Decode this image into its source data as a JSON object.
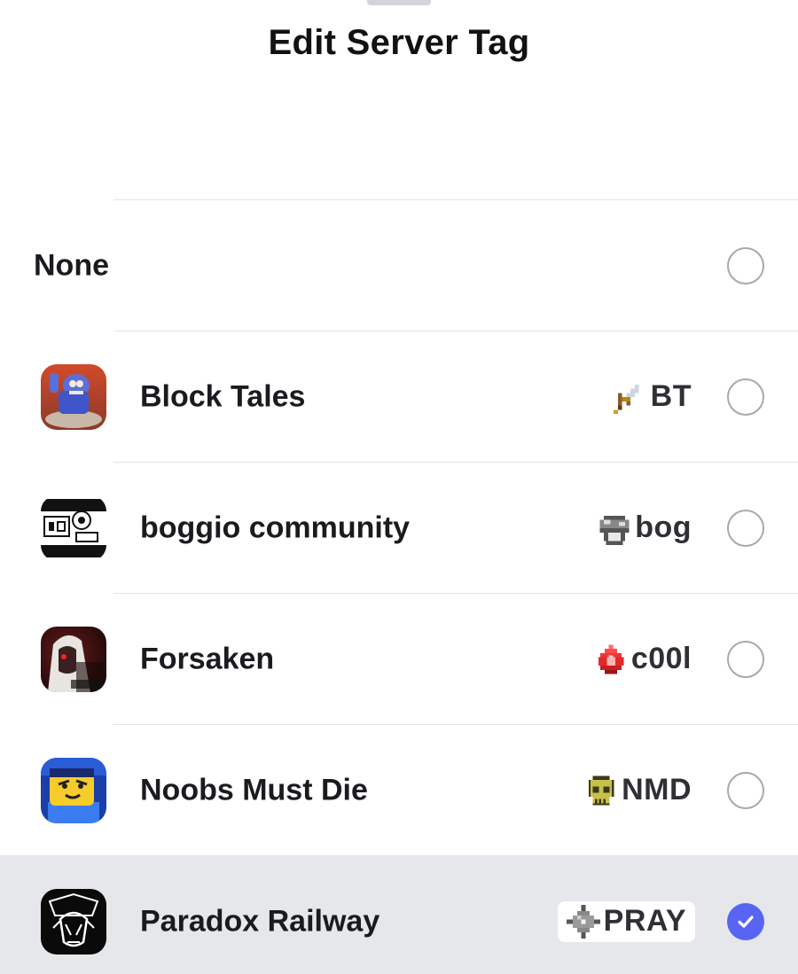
{
  "title": "Edit Server Tag",
  "none_option": {
    "label": "None",
    "selected": false
  },
  "servers": [
    {
      "name": "Block Tales",
      "tag_text": "BT",
      "tag_icon": "sword-icon",
      "avatar": "block-tales-avatar",
      "selected": false
    },
    {
      "name": "boggio community",
      "tag_text": "bog",
      "tag_icon": "mushroom-icon",
      "avatar": "boggio-avatar",
      "selected": false
    },
    {
      "name": "Forsaken",
      "tag_text": "c00l",
      "tag_icon": "flame-icon",
      "avatar": "forsaken-avatar",
      "selected": false
    },
    {
      "name": "Noobs Must Die",
      "tag_text": "NMD",
      "tag_icon": "skull-icon",
      "avatar": "noobs-avatar",
      "selected": false
    },
    {
      "name": "Paradox Railway",
      "tag_text": "PRAY",
      "tag_icon": "shuriken-icon",
      "avatar": "paradox-avatar",
      "selected": true
    }
  ],
  "colors": {
    "accent": "#5865f2",
    "selected_row": "#e6e7ea",
    "radio_border": "#a7a9b0"
  }
}
